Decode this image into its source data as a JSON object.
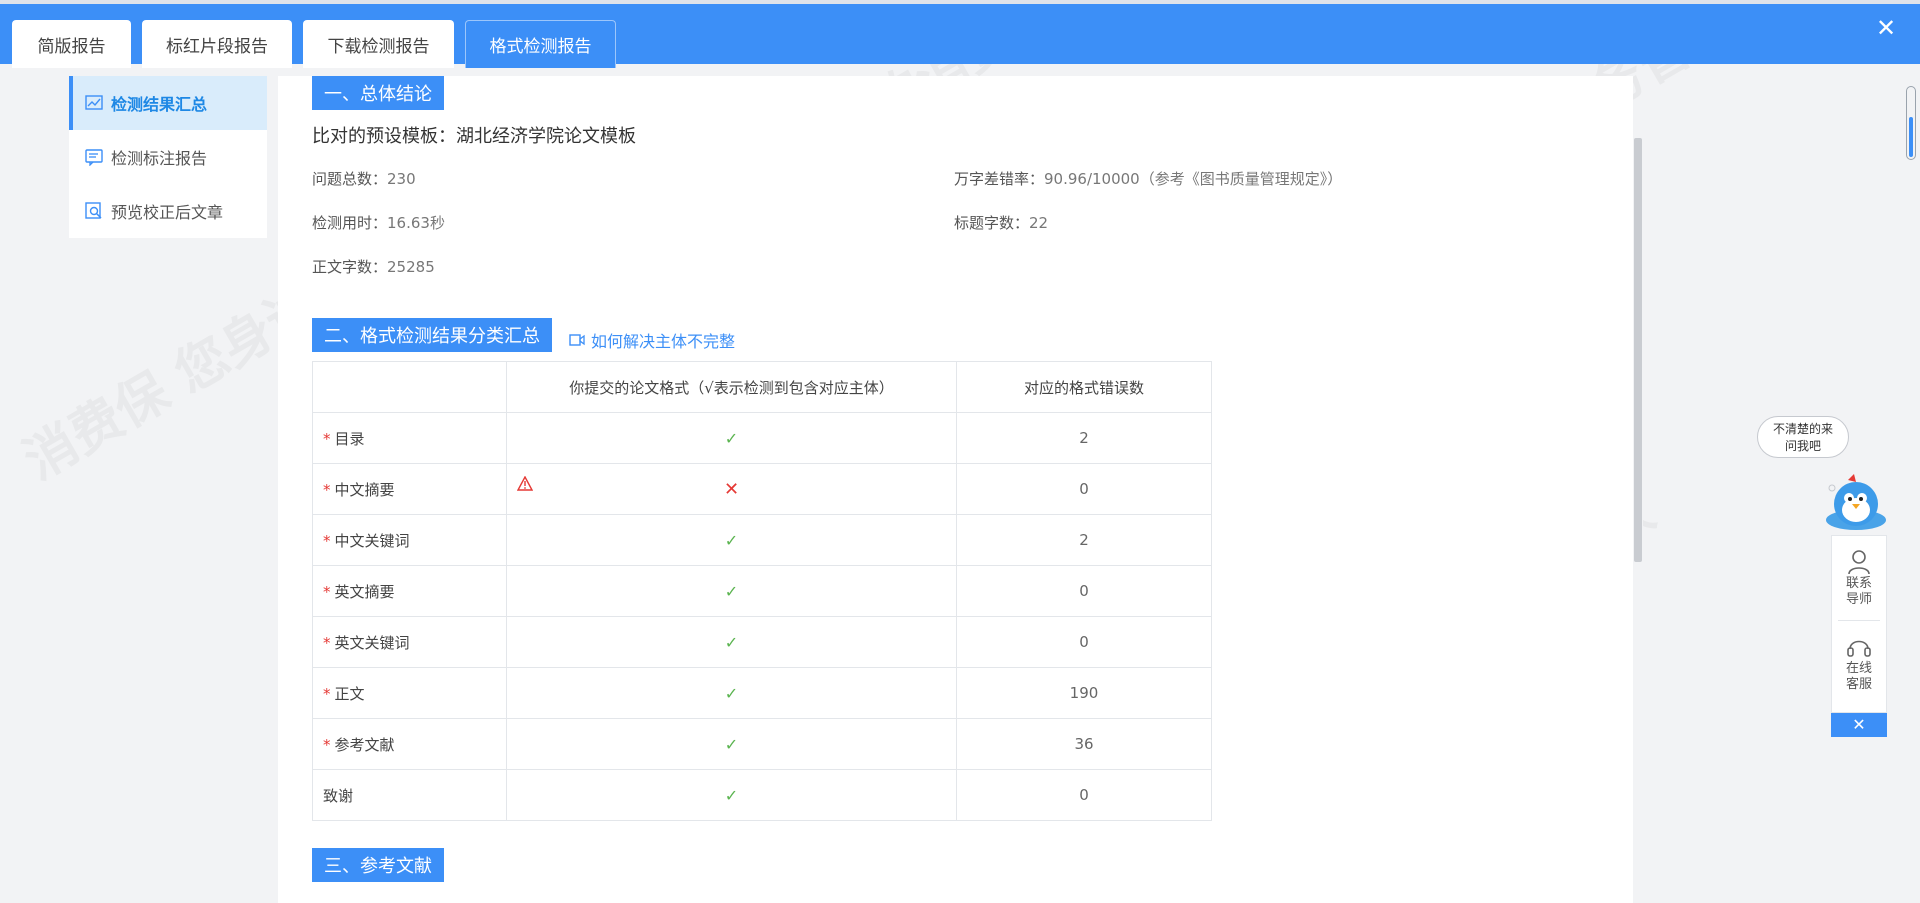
{
  "tabs": [
    {
      "label": "简版报告",
      "active": false
    },
    {
      "label": "标红片段报告",
      "active": false
    },
    {
      "label": "下载检测报告",
      "active": false
    },
    {
      "label": "格式检测报告",
      "active": true
    }
  ],
  "sidebar": {
    "items": [
      {
        "label": "检测结果汇总",
        "icon": "chart-icon",
        "active": true
      },
      {
        "label": "检测标注报告",
        "icon": "comment-icon",
        "active": false
      },
      {
        "label": "预览校正后文章",
        "icon": "preview-search-icon",
        "active": false
      }
    ]
  },
  "section1": {
    "title": "一、总体结论",
    "template_label": "比对的预设模板：",
    "template_value": "湖北经济学院论文模板",
    "stats": {
      "total_issues_label": "问题总数：",
      "total_issues": "230",
      "time_label": "检测用时：",
      "time": "16.63秒",
      "body_words_label": "正文字数：",
      "body_words": "25285",
      "error_rate_label": "万字差错率：",
      "error_rate": "90.96/10000（参考《图书质量管理规定》）",
      "title_words_label": "标题字数：",
      "title_words": "22"
    }
  },
  "section2": {
    "title": "二、格式检测结果分类汇总",
    "help_link": "如何解决主体不完整",
    "table": {
      "headers": [
        "",
        "你提交的论文格式（√表示检测到包含对应主体）",
        "对应的格式错误数"
      ],
      "rows": [
        {
          "name": "目录",
          "required": true,
          "status": "✓",
          "errors": "2",
          "warn": false
        },
        {
          "name": "中文摘要",
          "required": true,
          "status": "✕",
          "errors": "0",
          "warn": true
        },
        {
          "name": "中文关键词",
          "required": true,
          "status": "✓",
          "errors": "2",
          "warn": false
        },
        {
          "name": "英文摘要",
          "required": true,
          "status": "✓",
          "errors": "0",
          "warn": false
        },
        {
          "name": "英文关键词",
          "required": true,
          "status": "✓",
          "errors": "0",
          "warn": false
        },
        {
          "name": "正文",
          "required": true,
          "status": "✓",
          "errors": "190",
          "warn": false
        },
        {
          "name": "参考文献",
          "required": true,
          "status": "✓",
          "errors": "36",
          "warn": false
        },
        {
          "name": "致谢",
          "required": false,
          "status": "✓",
          "errors": "0",
          "warn": false
        }
      ],
      "required_mark": "*"
    }
  },
  "section3": {
    "title": "三、参考文献"
  },
  "helper": {
    "bubble": "不清楚的来问我吧",
    "contact_label": "联系导师",
    "service_label": "在线客服",
    "close_label": "✕"
  },
  "window": {
    "close_label": "✕"
  },
  "watermark_text": "消费保 您身边的消费服务管家",
  "colors": {
    "accent": "#3c8ff7",
    "check": "#5bb450",
    "error": "#e53935"
  }
}
